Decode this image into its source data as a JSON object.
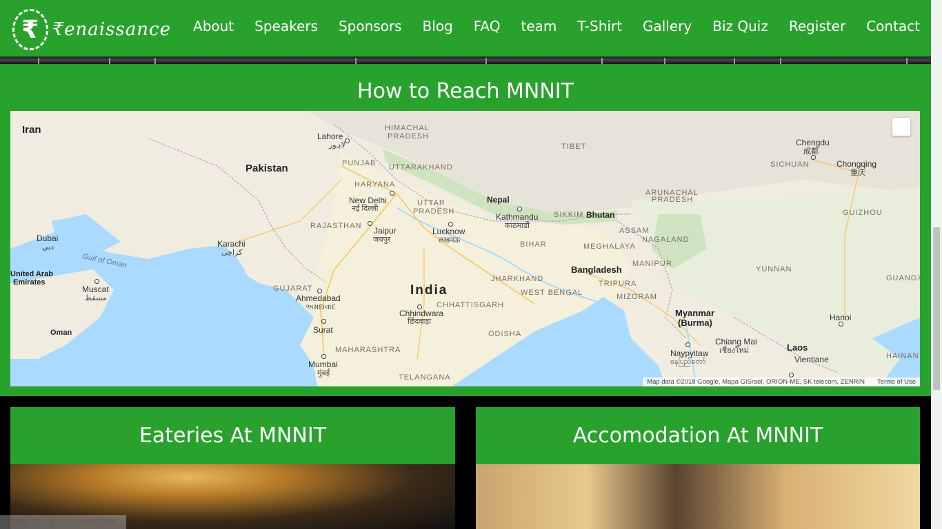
{
  "brand": {
    "logo_symbol": "₹",
    "logo_text": "₹enaissance"
  },
  "nav": {
    "items": [
      "About",
      "Speakers",
      "Sponsors",
      "Blog",
      "FAQ",
      "team",
      "T-Shirt",
      "Gallery",
      "Biz Quiz",
      "Register",
      "Contact"
    ]
  },
  "map_section": {
    "title": "How to Reach MNNIT",
    "labels": {
      "iran": "Iran",
      "pakistan": "Pakistan",
      "india": "India",
      "nepal": "Nepal",
      "bhutan": "Bhutan",
      "bangladesh": "Bangladesh",
      "myanmar": "Myanmar",
      "myanmar_alt": "(Burma)",
      "laos": "Laos",
      "oman": "Oman",
      "uae_1": "United Arab",
      "uae_2": "Emirates",
      "tibet": "TIBET",
      "himachal_1": "HIMACHAL",
      "himachal_2": "PRADESH",
      "punjab": "PUNJAB",
      "uttarakhand": "UTTARAKHAND",
      "haryana": "HARYANA",
      "uttar_1": "UTTAR",
      "uttar_2": "PRADESH",
      "rajasthan": "RAJASTHAN",
      "bihar": "BIHAR",
      "sikkim": "SIKKIM",
      "arunachal_1": "ARUNACHAL",
      "arunachal_2": "PRADESH",
      "assam": "ASSAM",
      "meghalaya": "MEGHALAYA",
      "nagaland": "NAGALAND",
      "manipur": "MANIPUR",
      "tripura": "TRIPURA",
      "mizoram": "MIZORAM",
      "jharkhand": "JHARKHAND",
      "west_bengal": "WEST BENGAL",
      "gujarat": "GUJARAT",
      "chhattisgarh": "CHHATTISGARH",
      "odisha": "ODISHA",
      "maharashtra": "MAHARASHTRA",
      "telangana": "TELANGANA",
      "sichuan": "SICHUAN",
      "guizhou": "GUIZHOU",
      "yunnan": "YUNNAN",
      "guangxi": "GUANGX",
      "hainan": "HAINAN",
      "lahore": "Lahore",
      "lahore_ur": "لاہور",
      "new_delhi": "New Delhi",
      "new_delhi_hi": "नई दिल्ली",
      "jaipur": "Jaipur",
      "jaipur_hi": "जयपुर",
      "lucknow": "Lucknow",
      "lucknow_hi": "लखनऊ",
      "kathmandu": "Kathmandu",
      "kathmandu_ne": "काठमाडौं",
      "karachi": "Karachi",
      "karachi_ur": "کراچی",
      "dubai": "Dubai",
      "dubai_ar": "دبي",
      "muscat": "Muscat",
      "muscat_ar": "مسقط",
      "ahmedabad": "Ahmedabad",
      "ahmedabad_gu": "અમદાવાદ",
      "surat": "Surat",
      "chhindwara": "Chhindwara",
      "chhindwara_hi": "छिंदवाड़ा",
      "mumbai": "Mumbai",
      "mumbai_hi": "मुंबई",
      "chengdu": "Chengdu",
      "chengdu_zh": "成都",
      "chongqing": "Chongqing",
      "chongqing_zh": "重庆",
      "hanoi": "Hanoi",
      "chiang_mai": "Chiang Mai",
      "chiang_mai_th": "เชียงใหม่",
      "naypyitaw": "Naypyitaw",
      "naypyitaw_my": "နေပြည်တော်",
      "vientiane": "Vientiane",
      "gulf_of_oman": "Gulf of Oman"
    },
    "attribution": "Map data ©2018 Google, Mapa GISrael, ORION-ME, SK telecom, ZENRIN",
    "terms": "Terms of Use"
  },
  "cards": {
    "eateries": "Eateries At MNNIT",
    "accomodation": "Accomodation At MNNIT"
  },
  "status": "Waiting for maps.googleapis.com..."
}
